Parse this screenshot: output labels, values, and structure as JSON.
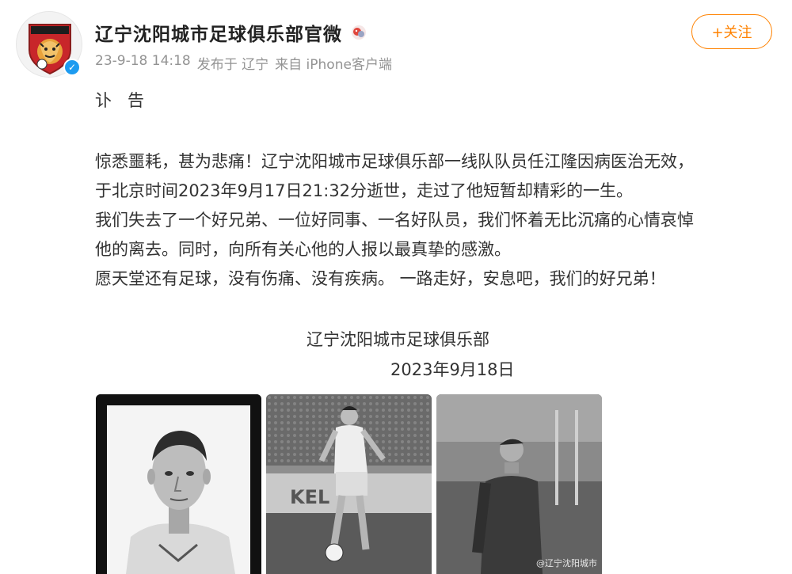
{
  "author": {
    "name": "辽宁沈阳城市足球俱乐部官微",
    "avatar_icon": "club-crest-icon",
    "verified_icon": "verified-check-icon",
    "badge_icon": "member-badge-icon"
  },
  "meta": {
    "time": "23-9-18 14:18",
    "location": "发布于 辽宁",
    "source": "来自 iPhone客户端"
  },
  "follow_button": {
    "label": "+关注",
    "color": "#ff8200"
  },
  "post": {
    "title": "讣告",
    "lines": [
      "惊悉噩耗，甚为悲痛！辽宁沈阳城市足球俱乐部一线队队员任江隆因病医治无效，",
      "于北京时间2023年9月17日21:32分逝世，走过了他短暂却精彩的一生。",
      "我们失去了一个好兄弟、一位好同事、一名好队员，我们怀着无比沉痛的心情哀悼",
      "他的离去。同时，向所有关心他的人报以最真挚的感激。",
      "愿天堂还有足球，没有伤痛、没有疾病。 一路走好，安息吧，我们的好兄弟！"
    ],
    "signature_org": "辽宁沈阳城市足球俱乐部",
    "signature_date": "2023年9月18日"
  },
  "photos": {
    "photo1": {
      "kind": "portrait"
    },
    "photo2": {
      "kind": "action",
      "ad_text": "KEL"
    },
    "photo3": {
      "kind": "sideline",
      "watermark": "@辽宁沈阳城市"
    }
  }
}
